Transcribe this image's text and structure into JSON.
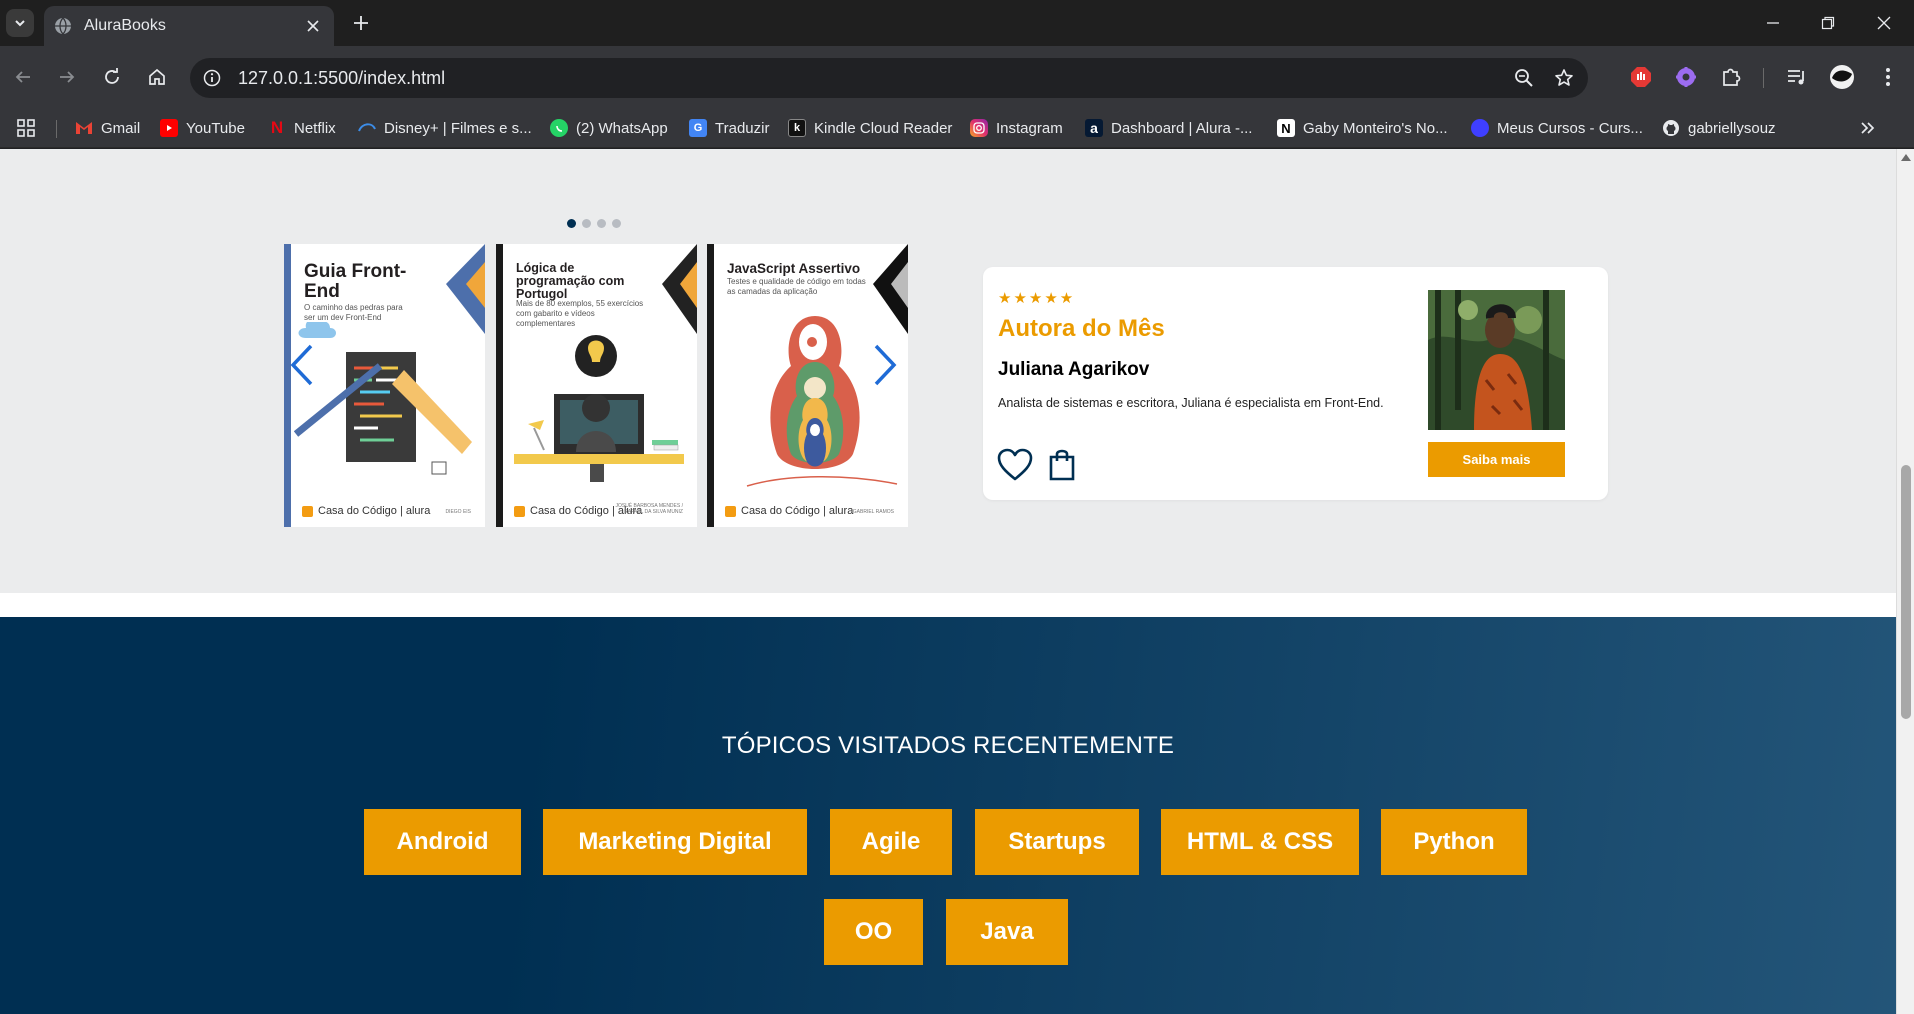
{
  "browser": {
    "tab_title": "AluraBooks",
    "url": "127.0.0.1:5500/index.html",
    "bookmarks": [
      {
        "label": "Gmail",
        "icon": "gmail-icon",
        "color": "#ea4335"
      },
      {
        "label": "YouTube",
        "icon": "youtube-icon",
        "color": "#ff0000"
      },
      {
        "label": "Netflix",
        "icon": "netflix-icon",
        "color": "#e50914"
      },
      {
        "label": "Disney+ | Filmes e s...",
        "icon": "disney-icon",
        "color": "#1a73e8"
      },
      {
        "label": "(2) WhatsApp",
        "icon": "whatsapp-icon",
        "color": "#25d366"
      },
      {
        "label": "Traduzir",
        "icon": "translate-icon",
        "color": "#4285f4"
      },
      {
        "label": "Kindle Cloud Reader",
        "icon": "kindle-icon",
        "color": "#000000"
      },
      {
        "label": "Instagram",
        "icon": "instagram-icon",
        "color": "#e1306c"
      },
      {
        "label": "Dashboard | Alura -...",
        "icon": "alura-icon",
        "color": "#051933"
      },
      {
        "label": "Gaby Monteiro's No...",
        "icon": "notion-icon",
        "color": "#ffffff"
      },
      {
        "label": "Meus Cursos - Curs...",
        "icon": "course-icon",
        "color": "#3f3fff"
      },
      {
        "label": "gabriellysouz",
        "icon": "github-icon",
        "color": "#ffffff"
      }
    ]
  },
  "carousel": {
    "active_dot": 0,
    "dot_count": 4,
    "books": [
      {
        "title": "Guia Front-End",
        "subtitle": "O caminho das pedras para ser um dev Front-End",
        "publisher": "Casa do Código | alura",
        "authors": "DIEGO EIS"
      },
      {
        "title": "Lógica de programação com Portugol",
        "subtitle": "Mais de 80 exemplos, 55 exercícios com gabarito e vídeos complementares",
        "publisher": "Casa do Código | alura",
        "authors": "JOSUÉ BARBOSA MENDES / RAFAEL DA SILVA MUNIZ"
      },
      {
        "title": "JavaScript Assertivo",
        "subtitle": "Testes e qualidade de código em todas as camadas da aplicação",
        "publisher": "Casa do Código | alura",
        "authors": "GABRIEL RAMOS"
      }
    ]
  },
  "author_card": {
    "stars": "★★★★★",
    "label": "Autora do Mês",
    "name": "Juliana Agarikov",
    "description": "Analista de sistemas e escritora, Juliana é especialista em Front-End.",
    "button": "Saiba mais"
  },
  "topics": {
    "title": "TÓPICOS VISITADOS RECENTEMENTE",
    "tags": [
      "Android",
      "Marketing Digital",
      "Agile",
      "Startups",
      "HTML & CSS",
      "Python",
      "OO",
      "Java"
    ]
  },
  "colors": {
    "accent": "#eb9b00",
    "navy": "#002f52"
  }
}
